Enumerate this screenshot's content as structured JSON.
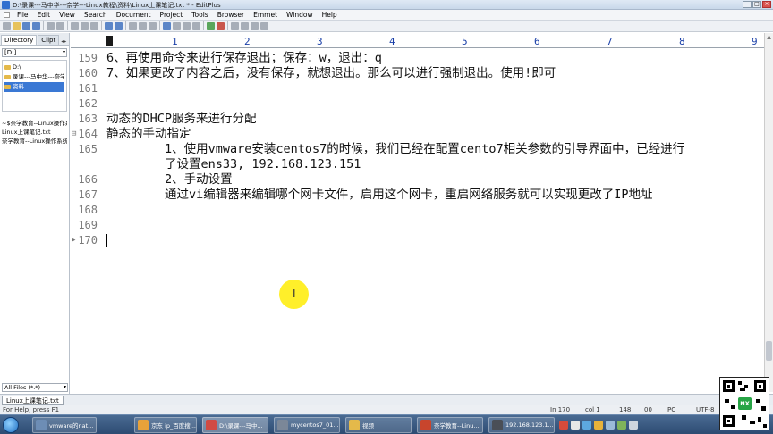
{
  "window": {
    "title": "D:\\录课---马中华---奈学---Linux教程\\资料\\Linux上课笔记.txt * - EditPlus"
  },
  "menu": [
    "File",
    "Edit",
    "View",
    "Search",
    "Document",
    "Project",
    "Tools",
    "Browser",
    "Emmet",
    "Window",
    "Help"
  ],
  "sidebar": {
    "tabs": [
      "Directory",
      "Clipt"
    ],
    "drive": "[D:]",
    "tree": [
      "D:\\",
      "录课---马中华---奈学",
      "资料"
    ],
    "files": [
      "~$奈学教育--Linux操作系",
      "Linux上课笔记.txt",
      "奈学教育--Linux操作系统"
    ],
    "filter": "All Files (*.*)"
  },
  "ruler": {
    "numbers": [
      "1",
      "2",
      "3",
      "4",
      "5",
      "6",
      "7",
      "8",
      "9"
    ]
  },
  "editor": {
    "lines": [
      {
        "num": "159",
        "text": "6、再使用命令来进行保存退出；保存：w，退出：q"
      },
      {
        "num": "160",
        "text": "7、如果更改了内容之后，没有保存，就想退出。那么可以进行强制退出。使用!即可"
      },
      {
        "num": "161",
        "text": ""
      },
      {
        "num": "162",
        "text": ""
      },
      {
        "num": "163",
        "text": "动态的DHCP服务来进行分配"
      },
      {
        "num": "164",
        "text": "静态的手动指定"
      },
      {
        "num": "165",
        "text": "        1、使用vmware安装centos7的时候，我们已经在配置cento7相关参数的引导界面中，已经进行"
      },
      {
        "num": "",
        "text": "        了设置ens33, 192.168.123.151"
      },
      {
        "num": "166",
        "text": "        2、手动设置"
      },
      {
        "num": "167",
        "text": "        通过vi编辑器来编辑哪个网卡文件，启用这个网卡，重启网络服务就可以实现更改了IP地址"
      },
      {
        "num": "168",
        "text": ""
      },
      {
        "num": "169",
        "text": ""
      },
      {
        "num": "170",
        "text": ""
      }
    ]
  },
  "doc_tab": "Linux上课笔记.txt",
  "status": {
    "help": "For Help, press F1",
    "line": "In 170",
    "col": "col 1",
    "count": "148",
    "hex": "00",
    "mode": "PC",
    "encoding": "UTF-8"
  },
  "taskbar": {
    "tasks": [
      {
        "label": "vmware的nat...",
        "color": "#6d8db5"
      },
      {
        "label": "京东 ip_百度搜...",
        "color": "#e8a23a"
      },
      {
        "label": "D:\\录课---马中...",
        "color": "#d14b43"
      },
      {
        "label": "mycentos7_01...",
        "color": "#7b8798"
      },
      {
        "label": "视频",
        "color": "#e4b94a"
      },
      {
        "label": "奈学教育--Linu...",
        "color": "#c8452d"
      },
      {
        "label": "192.168.123.1...",
        "color": "#4a4f57"
      }
    ]
  },
  "colors": {
    "line_number": "#7a7a7a",
    "ruler_numbers": "#1a3fa8",
    "cursor_highlight": "#ffef2a",
    "qr_badge": "#27a546"
  },
  "qr_badge_label": "NX"
}
